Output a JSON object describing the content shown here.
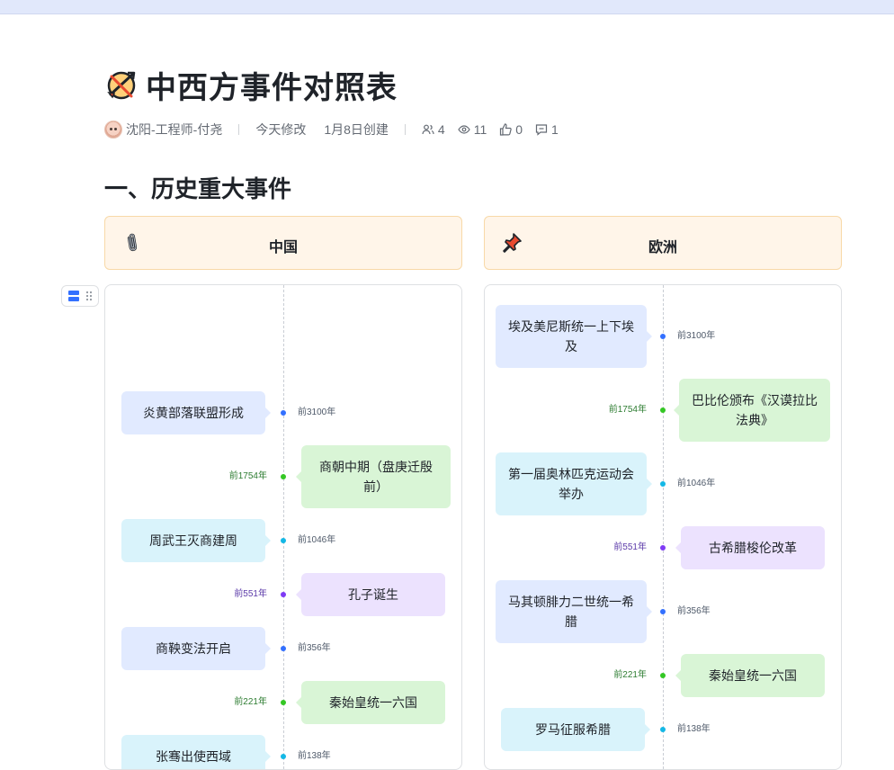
{
  "doc": {
    "title": "中西方事件对照表",
    "author": "沈阳-工程师-付尧",
    "modified": "今天修改",
    "created": "1月8日创建",
    "collaborators": "4",
    "views": "11",
    "likes": "0",
    "comments": "1"
  },
  "section": {
    "heading": "一、历史重大事件"
  },
  "columns": [
    {
      "name": "中国",
      "icon": "paperclip-icon"
    },
    {
      "name": "欧洲",
      "icon": "pushpin-icon"
    }
  ],
  "colors": {
    "blue": "#3370ff",
    "green": "#34c724",
    "cyan": "#14b8e6",
    "purple": "#7f3bf5",
    "blue_bg": "#e1eaff",
    "green_bg": "#d9f5d6",
    "cyan_bg": "#d9f3fb",
    "purple_bg": "#ece2fe",
    "header_bg": "#fff5e9"
  },
  "china_events": [
    {
      "text": "炎黄部落联盟形成",
      "date": "前3100年",
      "color": "blue"
    },
    {
      "text": "商朝中期（盘庚迁殷前）",
      "date": "前1754年",
      "color": "green"
    },
    {
      "text": "周武王灭商建周",
      "date": "前1046年",
      "color": "cyan"
    },
    {
      "text": "孔子诞生",
      "date": "前551年",
      "color": "purple"
    },
    {
      "text": "商鞅变法开启",
      "date": "前356年",
      "color": "blue"
    },
    {
      "text": "秦始皇统一六国",
      "date": "前221年",
      "color": "green"
    },
    {
      "text": "张骞出使西域",
      "date": "前138年",
      "color": "cyan"
    }
  ],
  "europe_events": [
    {
      "text": "埃及美尼斯统一上下埃及",
      "date": "前3100年",
      "color": "blue"
    },
    {
      "text": "巴比伦颁布《汉谟拉比法典》",
      "date": "前1754年",
      "color": "green"
    },
    {
      "text": "第一届奥林匹克运动会举办",
      "date": "前1046年",
      "color": "cyan"
    },
    {
      "text": "古希腊梭伦改革",
      "date": "前551年",
      "color": "purple"
    },
    {
      "text": "马其顿腓力二世统一希腊",
      "date": "前356年",
      "color": "blue"
    },
    {
      "text": "秦始皇统一六国",
      "date": "前221年",
      "color": "green"
    },
    {
      "text": "罗马征服希腊",
      "date": "前138年",
      "color": "cyan"
    }
  ]
}
